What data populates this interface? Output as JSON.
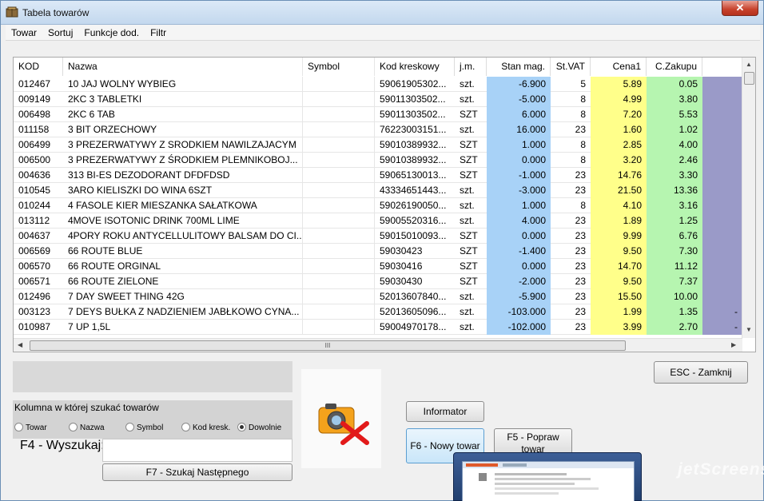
{
  "window": {
    "title": "Tabela towarów",
    "close_label": "✕"
  },
  "menu": [
    "Towar",
    "Sortuj",
    "Funkcje dod.",
    "Filtr"
  ],
  "columns": [
    "KOD",
    "Nazwa",
    "Symbol",
    "Kod kreskowy",
    "j.m.",
    "Stan mag.",
    "St.VAT",
    "Cena1",
    "C.Zakupu"
  ],
  "rows": [
    {
      "kod": "012467",
      "nazwa": "10 JAJ WOLNY WYBIEG",
      "symbol": "",
      "kod_kreskowy": "59061905302...",
      "jm": "szt.",
      "stan": "-6.900",
      "vat": "5",
      "cena1": "5.89",
      "zakup": "0.05",
      "last": ""
    },
    {
      "kod": "009149",
      "nazwa": "2KC 3 TABLETKI",
      "symbol": "",
      "kod_kreskowy": "59011303502...",
      "jm": "szt.",
      "stan": "-5.000",
      "vat": "8",
      "cena1": "4.99",
      "zakup": "3.80",
      "last": ""
    },
    {
      "kod": "006498",
      "nazwa": "2KC 6 TAB",
      "symbol": "",
      "kod_kreskowy": "59011303502...",
      "jm": "SZT",
      "stan": "6.000",
      "vat": "8",
      "cena1": "7.20",
      "zakup": "5.53",
      "last": ""
    },
    {
      "kod": "011158",
      "nazwa": "3 BIT ORZECHOWY",
      "symbol": "",
      "kod_kreskowy": "76223003151...",
      "jm": "szt.",
      "stan": "16.000",
      "vat": "23",
      "cena1": "1.60",
      "zakup": "1.02",
      "last": ""
    },
    {
      "kod": "006499",
      "nazwa": "3 PREZERWATYWY Z SRODKIEM NAWILZAJACYM",
      "symbol": "",
      "kod_kreskowy": "59010389932...",
      "jm": "SZT",
      "stan": "1.000",
      "vat": "8",
      "cena1": "2.85",
      "zakup": "4.00",
      "last": ""
    },
    {
      "kod": "006500",
      "nazwa": "3 PREZERWATYWY Z ŚRODKIEM PLEMNIKOBOJ...",
      "symbol": "",
      "kod_kreskowy": "59010389932...",
      "jm": "SZT",
      "stan": "0.000",
      "vat": "8",
      "cena1": "3.20",
      "zakup": "2.46",
      "last": ""
    },
    {
      "kod": "004636",
      "nazwa": "313 BI-ES DEZODORANT DFDFDSD",
      "symbol": "",
      "kod_kreskowy": "59065130013...",
      "jm": "SZT",
      "stan": "-1.000",
      "vat": "23",
      "cena1": "14.76",
      "zakup": "3.30",
      "last": ""
    },
    {
      "kod": "010545",
      "nazwa": "3ARO KIELISZKI DO WINA 6SZT",
      "symbol": "",
      "kod_kreskowy": "43334651443...",
      "jm": "szt.",
      "stan": "-3.000",
      "vat": "23",
      "cena1": "21.50",
      "zakup": "13.36",
      "last": ""
    },
    {
      "kod": "010244",
      "nazwa": "4 FASOLE KIER MIESZANKA SAŁATKOWA",
      "symbol": "",
      "kod_kreskowy": "59026190050...",
      "jm": "szt.",
      "stan": "1.000",
      "vat": "8",
      "cena1": "4.10",
      "zakup": "3.16",
      "last": ""
    },
    {
      "kod": "013112",
      "nazwa": "4MOVE ISOTONIC DRINK 700ML LIME",
      "symbol": "",
      "kod_kreskowy": "59005520316...",
      "jm": "szt.",
      "stan": "4.000",
      "vat": "23",
      "cena1": "1.89",
      "zakup": "1.25",
      "last": ""
    },
    {
      "kod": "004637",
      "nazwa": "4PORY ROKU ANTYCELLULITOWY BALSAM DO CI...",
      "symbol": "",
      "kod_kreskowy": "59015010093...",
      "jm": "SZT",
      "stan": "0.000",
      "vat": "23",
      "cena1": "9.99",
      "zakup": "6.76",
      "last": ""
    },
    {
      "kod": "006569",
      "nazwa": "66 ROUTE BLUE",
      "symbol": "",
      "kod_kreskowy": "59030423",
      "jm": "SZT",
      "stan": "-1.400",
      "vat": "23",
      "cena1": "9.50",
      "zakup": "7.30",
      "last": ""
    },
    {
      "kod": "006570",
      "nazwa": "66 ROUTE ORGINAL",
      "symbol": "",
      "kod_kreskowy": "59030416",
      "jm": "SZT",
      "stan": "0.000",
      "vat": "23",
      "cena1": "14.70",
      "zakup": "11.12",
      "last": ""
    },
    {
      "kod": "006571",
      "nazwa": "66 ROUTE ZIELONE",
      "symbol": "",
      "kod_kreskowy": "59030430",
      "jm": "SZT",
      "stan": "-2.000",
      "vat": "23",
      "cena1": "9.50",
      "zakup": "7.37",
      "last": ""
    },
    {
      "kod": "012496",
      "nazwa": "7 DAY SWEET THING 42G",
      "symbol": "",
      "kod_kreskowy": "52013607840...",
      "jm": "szt.",
      "stan": "-5.900",
      "vat": "23",
      "cena1": "15.50",
      "zakup": "10.00",
      "last": ""
    },
    {
      "kod": "003123",
      "nazwa": "7 DEYS BUŁKA Z NADZIENIEM JABŁKOWO CYNA...",
      "symbol": "",
      "kod_kreskowy": "52013605096...",
      "jm": "szt.",
      "stan": "-103.000",
      "vat": "23",
      "cena1": "1.99",
      "zakup": "1.35",
      "last": "-"
    },
    {
      "kod": "010987",
      "nazwa": "7 UP 1,5L",
      "symbol": "",
      "kod_kreskowy": "59004970178...",
      "jm": "szt.",
      "stan": "-102.000",
      "vat": "23",
      "cena1": "3.99",
      "zakup": "2.70",
      "last": "-"
    }
  ],
  "search": {
    "title": "Kolumna w której szukać towarów",
    "options": [
      "Towar",
      "Nazwa",
      "Symbol",
      "Kod kresk.",
      "Dowolnie"
    ],
    "selected": "Dowolnie",
    "f4_label": "F4 - Wyszukaj:",
    "input_value": "",
    "f7_label": "F7 - Szukaj Następnego"
  },
  "buttons": {
    "esc": "ESC - Zamknij",
    "informator": "Informator",
    "f6": "F6 - Nowy towar",
    "f5": "F5 - Popraw towar"
  },
  "scroll": {
    "h_thumb": "III"
  },
  "watermark": "jetScreenshot",
  "icons": {
    "title": "app-icon",
    "no_image": "camera-remove-icon"
  }
}
